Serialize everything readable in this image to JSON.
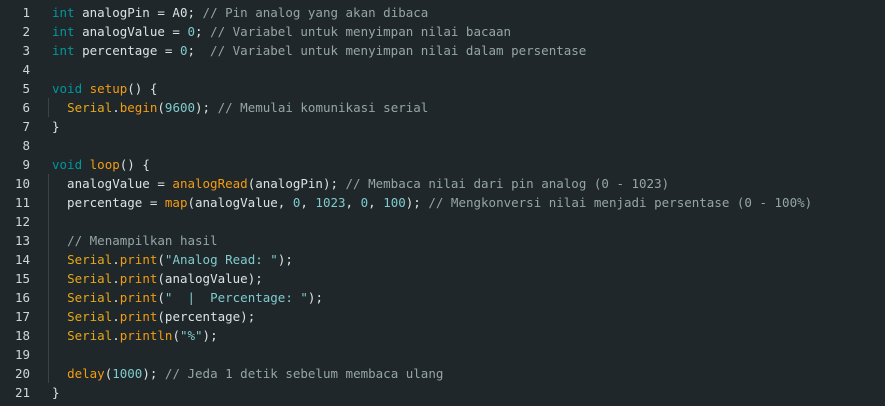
{
  "lines": [
    {
      "n": "1",
      "tokens": [
        {
          "t": "int",
          "c": "kw"
        },
        {
          "t": " analogPin = ",
          "c": "txt"
        },
        {
          "t": "A0",
          "c": "txt"
        },
        {
          "t": "; ",
          "c": "txt"
        },
        {
          "t": "// Pin analog yang akan dibaca",
          "c": "cm"
        }
      ]
    },
    {
      "n": "2",
      "tokens": [
        {
          "t": "int",
          "c": "kw"
        },
        {
          "t": " analogValue = ",
          "c": "txt"
        },
        {
          "t": "0",
          "c": "num"
        },
        {
          "t": "; ",
          "c": "txt"
        },
        {
          "t": "// Variabel untuk menyimpan nilai bacaan",
          "c": "cm"
        }
      ]
    },
    {
      "n": "3",
      "tokens": [
        {
          "t": "int",
          "c": "kw"
        },
        {
          "t": " percentage = ",
          "c": "txt"
        },
        {
          "t": "0",
          "c": "num"
        },
        {
          "t": ";  ",
          "c": "txt"
        },
        {
          "t": "// Variabel untuk menyimpan nilai dalam persentase",
          "c": "cm"
        }
      ]
    },
    {
      "n": "4",
      "tokens": []
    },
    {
      "n": "5",
      "tokens": [
        {
          "t": "void",
          "c": "kw"
        },
        {
          "t": " ",
          "c": "txt"
        },
        {
          "t": "setup",
          "c": "fn"
        },
        {
          "t": "() {",
          "c": "txt"
        }
      ]
    },
    {
      "n": "6",
      "tokens": [
        {
          "t": "  ",
          "c": "txt"
        },
        {
          "t": "Serial",
          "c": "cls"
        },
        {
          "t": ".",
          "c": "txt"
        },
        {
          "t": "begin",
          "c": "fn"
        },
        {
          "t": "(",
          "c": "txt"
        },
        {
          "t": "9600",
          "c": "num"
        },
        {
          "t": "); ",
          "c": "txt"
        },
        {
          "t": "// Memulai komunikasi serial",
          "c": "cm"
        }
      ]
    },
    {
      "n": "7",
      "tokens": [
        {
          "t": "}",
          "c": "txt"
        }
      ]
    },
    {
      "n": "8",
      "tokens": []
    },
    {
      "n": "9",
      "tokens": [
        {
          "t": "void",
          "c": "kw"
        },
        {
          "t": " ",
          "c": "txt"
        },
        {
          "t": "loop",
          "c": "fn"
        },
        {
          "t": "() {",
          "c": "txt"
        }
      ]
    },
    {
      "n": "10",
      "tokens": [
        {
          "t": "  analogValue = ",
          "c": "txt"
        },
        {
          "t": "analogRead",
          "c": "fn"
        },
        {
          "t": "(analogPin); ",
          "c": "txt"
        },
        {
          "t": "// Membaca nilai dari pin analog (0 - 1023)",
          "c": "cm"
        }
      ]
    },
    {
      "n": "11",
      "tokens": [
        {
          "t": "  percentage = ",
          "c": "txt"
        },
        {
          "t": "map",
          "c": "fn"
        },
        {
          "t": "(analogValue, ",
          "c": "txt"
        },
        {
          "t": "0",
          "c": "num"
        },
        {
          "t": ", ",
          "c": "txt"
        },
        {
          "t": "1023",
          "c": "num"
        },
        {
          "t": ", ",
          "c": "txt"
        },
        {
          "t": "0",
          "c": "num"
        },
        {
          "t": ", ",
          "c": "txt"
        },
        {
          "t": "100",
          "c": "num"
        },
        {
          "t": "); ",
          "c": "txt"
        },
        {
          "t": "// Mengkonversi nilai menjadi persentase (0 - 100%)",
          "c": "cm"
        }
      ]
    },
    {
      "n": "12",
      "tokens": []
    },
    {
      "n": "13",
      "tokens": [
        {
          "t": "  ",
          "c": "txt"
        },
        {
          "t": "// Menampilkan hasil",
          "c": "cm"
        }
      ]
    },
    {
      "n": "14",
      "tokens": [
        {
          "t": "  ",
          "c": "txt"
        },
        {
          "t": "Serial",
          "c": "cls"
        },
        {
          "t": ".",
          "c": "txt"
        },
        {
          "t": "print",
          "c": "fn"
        },
        {
          "t": "(",
          "c": "txt"
        },
        {
          "t": "\"Analog Read: \"",
          "c": "str"
        },
        {
          "t": ");",
          "c": "txt"
        }
      ]
    },
    {
      "n": "15",
      "tokens": [
        {
          "t": "  ",
          "c": "txt"
        },
        {
          "t": "Serial",
          "c": "cls"
        },
        {
          "t": ".",
          "c": "txt"
        },
        {
          "t": "print",
          "c": "fn"
        },
        {
          "t": "(analogValue);",
          "c": "txt"
        }
      ]
    },
    {
      "n": "16",
      "tokens": [
        {
          "t": "  ",
          "c": "txt"
        },
        {
          "t": "Serial",
          "c": "cls"
        },
        {
          "t": ".",
          "c": "txt"
        },
        {
          "t": "print",
          "c": "fn"
        },
        {
          "t": "(",
          "c": "txt"
        },
        {
          "t": "\"  |  Percentage: \"",
          "c": "str"
        },
        {
          "t": ");",
          "c": "txt"
        }
      ]
    },
    {
      "n": "17",
      "tokens": [
        {
          "t": "  ",
          "c": "txt"
        },
        {
          "t": "Serial",
          "c": "cls"
        },
        {
          "t": ".",
          "c": "txt"
        },
        {
          "t": "print",
          "c": "fn"
        },
        {
          "t": "(percentage);",
          "c": "txt"
        }
      ]
    },
    {
      "n": "18",
      "tokens": [
        {
          "t": "  ",
          "c": "txt"
        },
        {
          "t": "Serial",
          "c": "cls"
        },
        {
          "t": ".",
          "c": "txt"
        },
        {
          "t": "println",
          "c": "fn"
        },
        {
          "t": "(",
          "c": "txt"
        },
        {
          "t": "\"%\"",
          "c": "str"
        },
        {
          "t": ");",
          "c": "txt"
        }
      ]
    },
    {
      "n": "19",
      "tokens": []
    },
    {
      "n": "20",
      "tokens": [
        {
          "t": "  ",
          "c": "txt"
        },
        {
          "t": "delay",
          "c": "fn"
        },
        {
          "t": "(",
          "c": "txt"
        },
        {
          "t": "1000",
          "c": "num"
        },
        {
          "t": "); ",
          "c": "txt"
        },
        {
          "t": "// Jeda 1 detik sebelum membaca ulang",
          "c": "cm"
        }
      ]
    },
    {
      "n": "21",
      "tokens": [
        {
          "t": "}",
          "c": "txt"
        }
      ]
    }
  ]
}
